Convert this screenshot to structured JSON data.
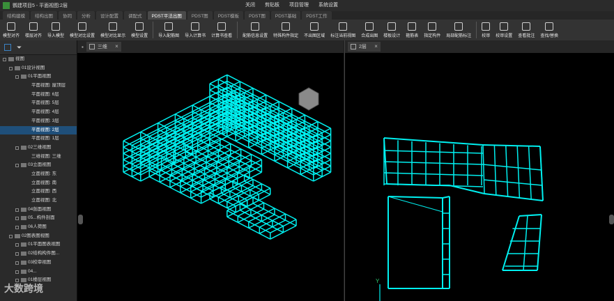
{
  "window": {
    "title": "鹦建项目5 - 平面视图:2层"
  },
  "top_menu": [
    {
      "label": "关闭"
    },
    {
      "label": "剪贴板"
    },
    {
      "label": "项目管理"
    },
    {
      "label": "系统设置"
    }
  ],
  "tabs": [
    "结构建模",
    "结构出图",
    "协同",
    "分析",
    "设计配置",
    "调配式",
    "PDST平法出图",
    "PDST图",
    "PDST模板",
    "PDST图",
    "PDST基础",
    "PDST工作"
  ],
  "active_tab_index": 6,
  "toolbar": [
    "模型对齐",
    "楼层对齐",
    "导入模型",
    "模型对比设置",
    "模型对比显示",
    "模型设置",
    "导入配筋图",
    "导入计算书",
    "计算书查看",
    "配筋信息设置",
    "特殊构件指定",
    "不出图区域",
    "标注当前视图",
    "合成出图",
    "楼板设计",
    "箍筋表",
    "指定构件",
    "局部配筋标注",
    "校审",
    "校审设置",
    "查看批注",
    "查找/替换"
  ],
  "tree": [
    {
      "label": "视图",
      "level": 0,
      "type": "folder"
    },
    {
      "label": "01设计视图",
      "level": 1,
      "type": "folder"
    },
    {
      "label": "01平面视图",
      "level": 2,
      "type": "folder"
    },
    {
      "label": "平面视图: 屋顶层",
      "level": 3,
      "type": "item"
    },
    {
      "label": "平面视图: 6层",
      "level": 3,
      "type": "item"
    },
    {
      "label": "平面视图: 5层",
      "level": 3,
      "type": "item"
    },
    {
      "label": "平面视图: 4层",
      "level": 3,
      "type": "item"
    },
    {
      "label": "平面视图: 3层",
      "level": 3,
      "type": "item"
    },
    {
      "label": "平面视图: 2层",
      "level": 3,
      "type": "item",
      "selected": true
    },
    {
      "label": "平面视图: 1层",
      "level": 3,
      "type": "item"
    },
    {
      "label": "02三维视图",
      "level": 2,
      "type": "folder"
    },
    {
      "label": "三维视图: 三维",
      "level": 3,
      "type": "item"
    },
    {
      "label": "03立面视图",
      "level": 2,
      "type": "folder"
    },
    {
      "label": "立面视图: 东",
      "level": 3,
      "type": "item"
    },
    {
      "label": "立面视图: 南",
      "level": 3,
      "type": "item"
    },
    {
      "label": "立面视图: 西",
      "level": 3,
      "type": "item"
    },
    {
      "label": "立面视图: 北",
      "level": 3,
      "type": "item"
    },
    {
      "label": "04剖面视图",
      "level": 2,
      "type": "folder"
    },
    {
      "label": "05...构件剖面",
      "level": 2,
      "type": "folder"
    },
    {
      "label": "06人荷图",
      "level": 2,
      "type": "folder"
    },
    {
      "label": "02图表图视图",
      "level": 1,
      "type": "folder"
    },
    {
      "label": "01平面图表视图",
      "level": 2,
      "type": "folder"
    },
    {
      "label": "02结构构件图...",
      "level": 2,
      "type": "folder"
    },
    {
      "label": "03校审视图",
      "level": 2,
      "type": "folder"
    },
    {
      "label": "04...",
      "level": 2,
      "type": "folder"
    },
    {
      "label": "01楼层视图",
      "level": 2,
      "type": "folder"
    }
  ],
  "views": {
    "left_tab": "三维",
    "right_tab": "2层"
  },
  "axis_labels": {
    "y": "Y",
    "x": "X"
  },
  "watermark": "大数跨境",
  "colors": {
    "structure": "#00f0f0",
    "background": "#000000",
    "selection": "#1f4f7a"
  }
}
